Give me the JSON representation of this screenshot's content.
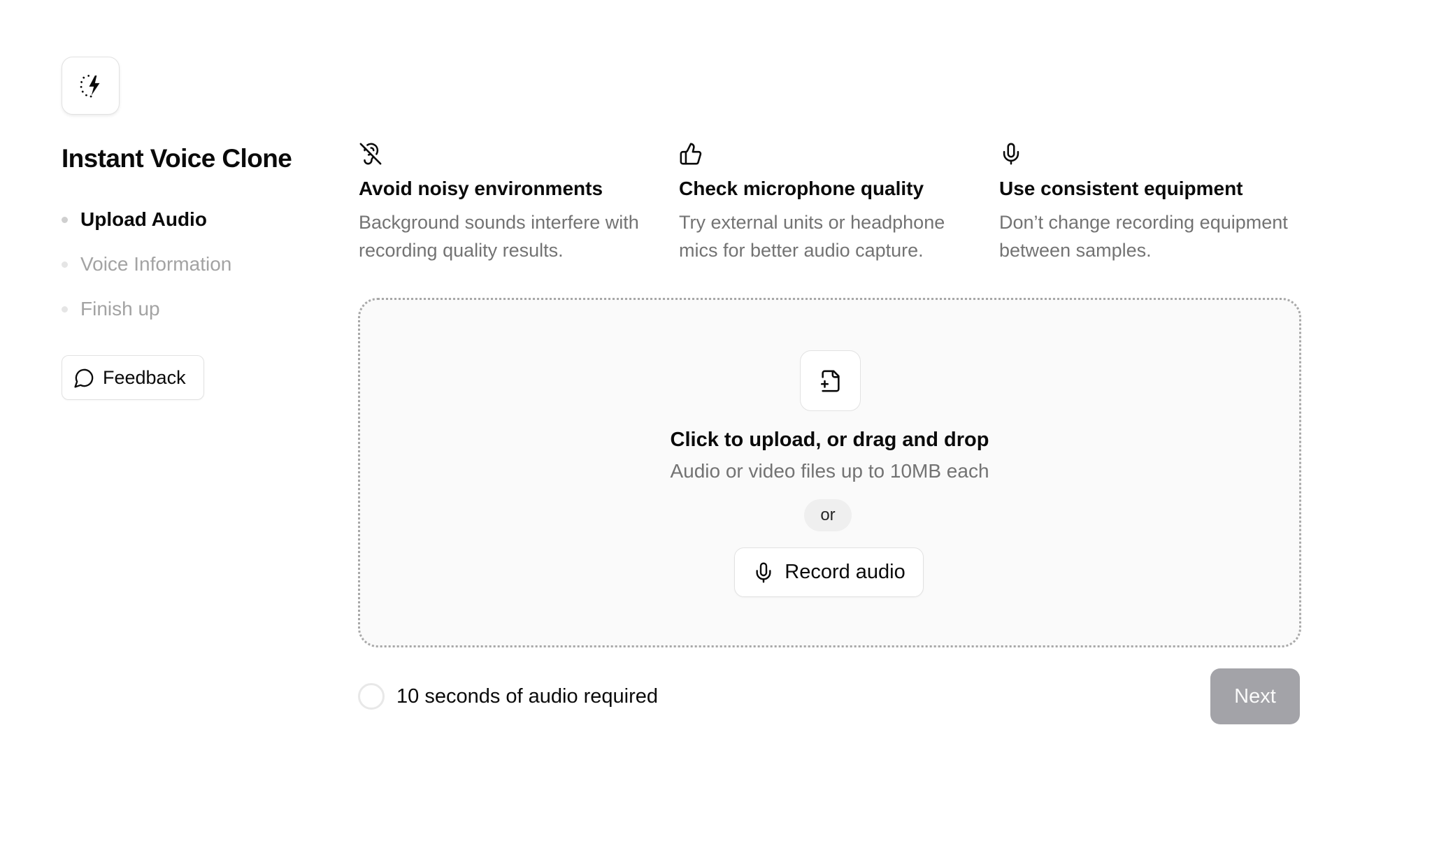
{
  "sidebar": {
    "title": "Instant Voice Clone",
    "steps": [
      {
        "label": "Upload Audio",
        "state": "active"
      },
      {
        "label": "Voice Information",
        "state": "inactive"
      },
      {
        "label": "Finish up",
        "state": "inactive"
      }
    ],
    "feedback_label": "Feedback"
  },
  "tips": [
    {
      "icon": "ear-off-icon",
      "title": "Avoid noisy environments",
      "description": "Background sounds interfere with recording quality results."
    },
    {
      "icon": "thumbs-up-icon",
      "title": "Check microphone quality",
      "description": "Try external units or headphone mics for better audio capture."
    },
    {
      "icon": "microphone-icon",
      "title": "Use consistent equipment",
      "description": "Don’t change recording equipment between samples."
    }
  ],
  "upload": {
    "title": "Click to upload, or drag and drop",
    "subtitle": "Audio or video files up to 10MB each",
    "separator": "or",
    "record_label": "Record audio"
  },
  "footer": {
    "requirement": "10 seconds of audio required",
    "requirement_progress": 0,
    "next_label": "Next",
    "next_disabled": true
  },
  "colors": {
    "text_primary": "#0a0a0a",
    "text_muted": "#737373",
    "text_step_inactive": "#a3a3a3",
    "next_disabled_bg": "#a3a3a8",
    "dropzone_bg": "#fafafa",
    "dropzone_border": "#a8a8a8"
  }
}
